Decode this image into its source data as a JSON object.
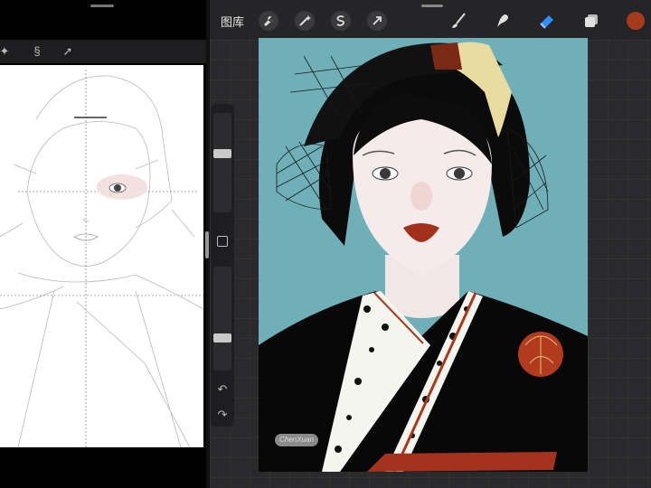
{
  "topbar": {
    "gallery_label": "图库",
    "icons": [
      "wrench-icon",
      "magic-wand-icon",
      "selection-s-icon",
      "transform-arrow-icon"
    ],
    "tools": [
      "brush-icon",
      "smudge-icon",
      "eraser-icon",
      "layers-icon"
    ],
    "active_tool": "eraser",
    "current_color": "#a53a1c"
  },
  "left_pane": {
    "icons": [
      "magic-wand-icon",
      "selection-s-icon",
      "transform-arrow-icon"
    ]
  },
  "sidebar": {
    "brush_size_level": 0.6,
    "opacity_level": 0.3,
    "undo": "↶",
    "redo": "↷"
  },
  "artwork": {
    "background_color": "#6fb0b8",
    "signature_text": "ChenXuan"
  }
}
